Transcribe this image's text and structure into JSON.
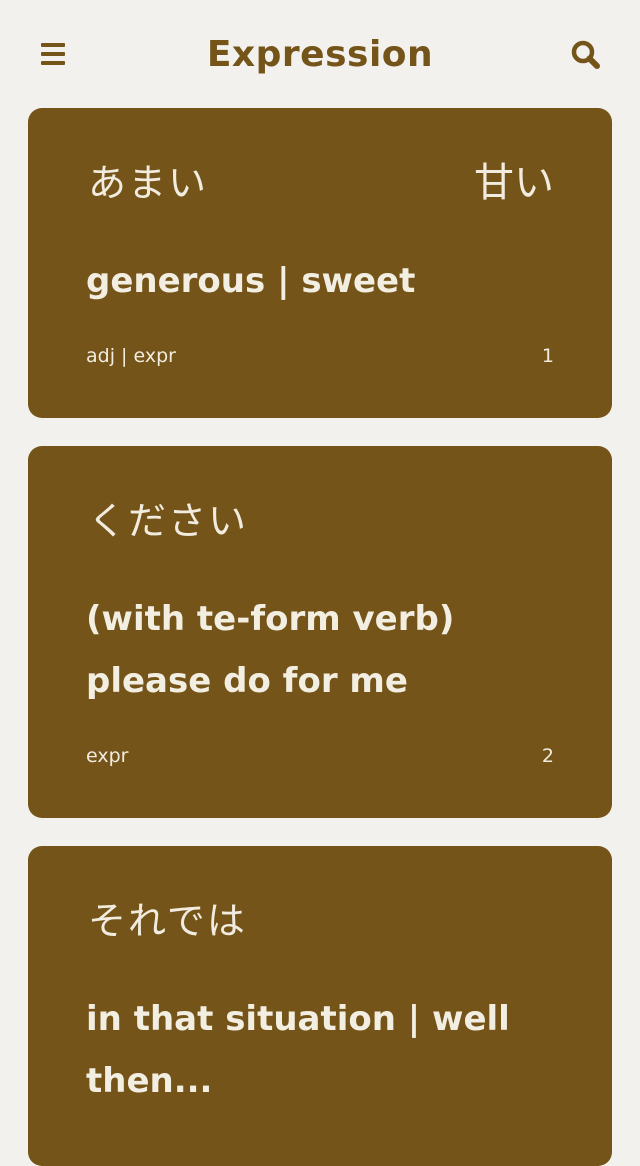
{
  "header": {
    "title": "Expression",
    "menu_icon": "hamburger-menu-icon",
    "search_icon": "search-icon"
  },
  "colors": {
    "accent": "#745418",
    "background": "#f3f1ee",
    "card_text": "#f3eee2"
  },
  "cards": [
    {
      "kana": "あまい",
      "kanji": "甘い",
      "meaning": "generous | sweet",
      "pos": "adj | expr",
      "number": "1"
    },
    {
      "kana": "ください",
      "kanji": "",
      "meaning": "(with te-form verb) please do for me",
      "pos": "expr",
      "number": "2"
    },
    {
      "kana": "それでは",
      "kanji": "",
      "meaning": "in that situation | well then...",
      "pos": "",
      "number": ""
    }
  ]
}
